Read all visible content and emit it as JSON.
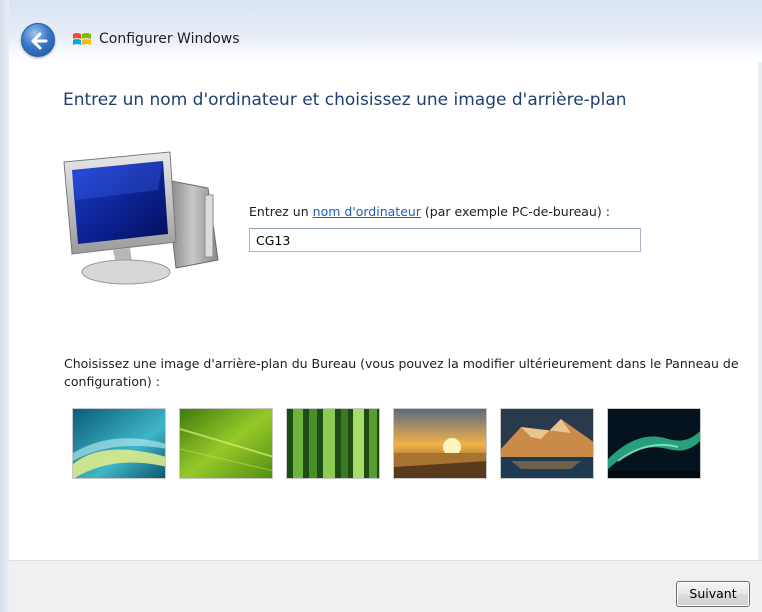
{
  "window": {
    "title": "Configurer Windows"
  },
  "heading": "Entrez un nom d'ordinateur et choisissez une image d'arrière-plan",
  "computer_name": {
    "label_prefix": "Entrez un ",
    "label_link": "nom d'ordinateur",
    "label_suffix": " (par exemple PC-de-bureau) :",
    "value": "CG13"
  },
  "background": {
    "label": "Choisissez une image d'arrière-plan du Bureau (vous pouvez la modifier ultérieurement dans le Panneau de configuration) :",
    "thumbnails": [
      {
        "name": "aurora-swirl",
        "colors": [
          "#0d6f8e",
          "#49c1c9",
          "#e8e88a"
        ]
      },
      {
        "name": "green-leaf",
        "colors": [
          "#4d8a12",
          "#9ccf2e",
          "#d8ee6a"
        ]
      },
      {
        "name": "bamboo",
        "colors": [
          "#1d4d14",
          "#5fa23a",
          "#b4dd73"
        ]
      },
      {
        "name": "sunset-field",
        "colors": [
          "#3a2a1a",
          "#f0a43a",
          "#fbe7a6"
        ]
      },
      {
        "name": "mountain-lake",
        "colors": [
          "#1e2b3a",
          "#c7874a",
          "#e9c68e"
        ]
      },
      {
        "name": "northern-lights",
        "colors": [
          "#04131f",
          "#1f7a63",
          "#7fe0b8"
        ]
      }
    ]
  },
  "footer": {
    "next_label": "Suivant"
  }
}
